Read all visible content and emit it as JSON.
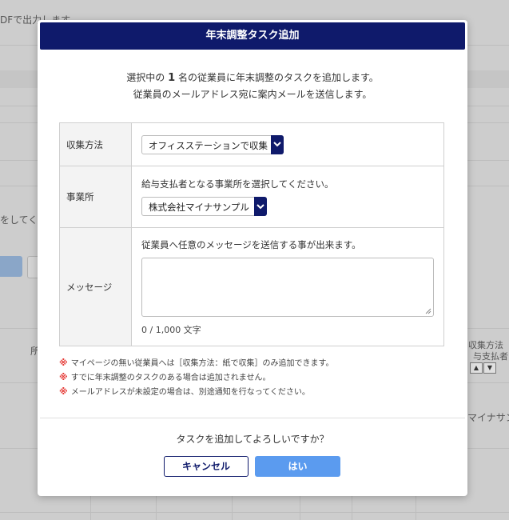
{
  "background": {
    "top_text": "DFで出力します",
    "left_fragment": "をしてく",
    "col_fragment": "所",
    "right_header_line1": "収集方法",
    "right_header_line2": "与支払者)",
    "right_cell": "マイナサン"
  },
  "modal": {
    "title": "年末調整タスク追加",
    "intro": {
      "line1_prefix": "選択中の",
      "count": "1",
      "line1_suffix": "名の従業員に年末調整のタスクを追加します。",
      "line2": "従業員のメールアドレス宛に案内メールを送信します。"
    },
    "form": {
      "collection": {
        "label": "収集方法",
        "selected": "オフィスステーションで収集"
      },
      "office": {
        "label": "事業所",
        "hint": "給与支払者となる事業所を選択してください。",
        "selected": "株式会社マイナサンプル"
      },
      "message": {
        "label": "メッセージ",
        "hint": "従業員へ任意のメッセージを送信する事が出来ます。",
        "value": "",
        "counter": "0 / 1,000 文字"
      }
    },
    "notes": [
      {
        "mark": "※",
        "text": "マイページの無い従業員へは［収集方法：紙で収集］のみ追加できます。"
      },
      {
        "mark": "※",
        "text": "すでに年末調整のタスクのある場合は追加されません。"
      },
      {
        "mark": "※",
        "text": "メールアドレスが未設定の場合は、別途通知を行なってください。"
      }
    ],
    "confirm_text": "タスクを追加してよろしいですか？",
    "buttons": {
      "cancel": "キャンセル",
      "yes": "はい"
    }
  },
  "colors": {
    "header": "#0f1a6b",
    "primary_button": "#5b9bef",
    "note_mark": "#e53935"
  }
}
